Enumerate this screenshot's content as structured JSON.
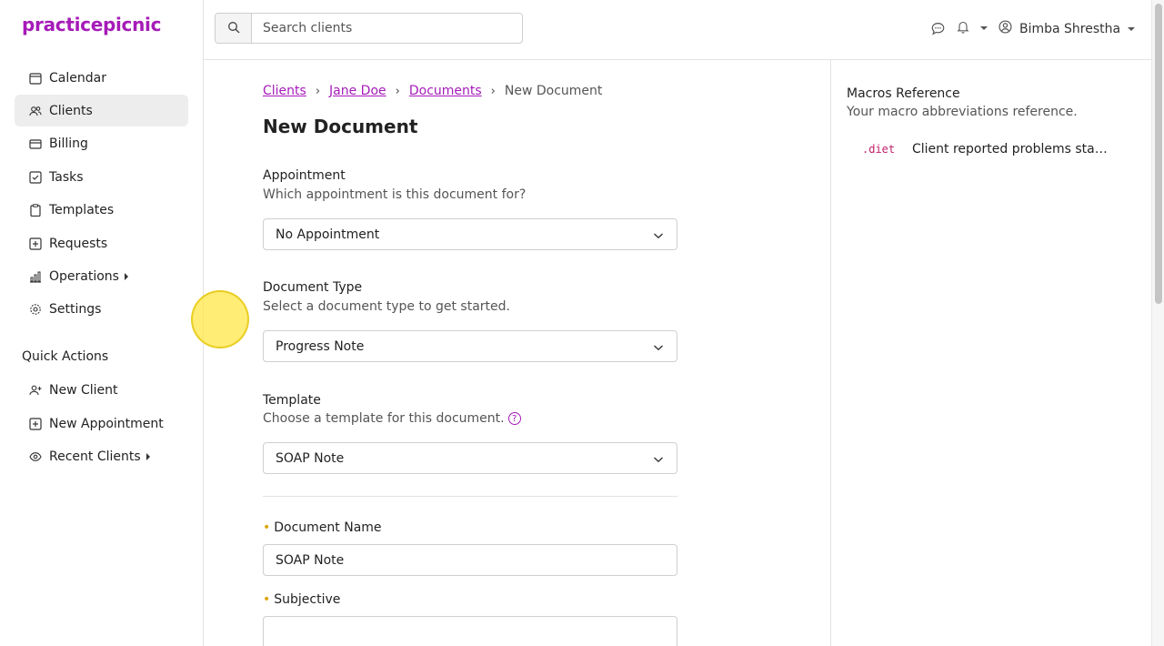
{
  "app": {
    "logo": "practicepicnic",
    "brand_color": "#a51bb8"
  },
  "sidebar": {
    "items": [
      {
        "label": "Calendar",
        "icon": "calendar-icon"
      },
      {
        "label": "Clients",
        "icon": "users-icon",
        "active": true
      },
      {
        "label": "Billing",
        "icon": "credit-card-icon"
      },
      {
        "label": "Tasks",
        "icon": "checkbox-icon"
      },
      {
        "label": "Templates",
        "icon": "clipboard-icon"
      },
      {
        "label": "Requests",
        "icon": "plus-box-icon"
      },
      {
        "label": "Operations",
        "icon": "bar-chart-icon",
        "expandable": true
      },
      {
        "label": "Settings",
        "icon": "gear-icon"
      }
    ],
    "quick_actions_title": "Quick Actions",
    "quick_actions": [
      {
        "label": "New Client",
        "icon": "user-plus-icon"
      },
      {
        "label": "New Appointment",
        "icon": "plus-box-icon"
      },
      {
        "label": "Recent Clients",
        "icon": "eye-icon",
        "expandable": true
      }
    ]
  },
  "header": {
    "search_placeholder": "Search clients",
    "user_name": "Bimba Shrestha"
  },
  "breadcrumb": [
    "Clients",
    "Jane Doe",
    "Documents",
    "New Document"
  ],
  "form": {
    "title": "New Document",
    "appointment": {
      "label": "Appointment",
      "help": "Which appointment is this document for?",
      "value": "No Appointment"
    },
    "document_type": {
      "label": "Document Type",
      "help": "Select a document type to get started.",
      "value": "Progress Note"
    },
    "template": {
      "label": "Template",
      "help": "Choose a template for this document.",
      "value": "SOAP Note"
    },
    "document_name": {
      "label": "Document Name",
      "value": "SOAP Note"
    },
    "subjective": {
      "label": "Subjective",
      "value": ""
    }
  },
  "macros": {
    "title": "Macros Reference",
    "subtitle": "Your macro abbreviations reference.",
    "items": [
      {
        "code": ".diet",
        "text": "Client reported problems stayi…"
      }
    ]
  }
}
